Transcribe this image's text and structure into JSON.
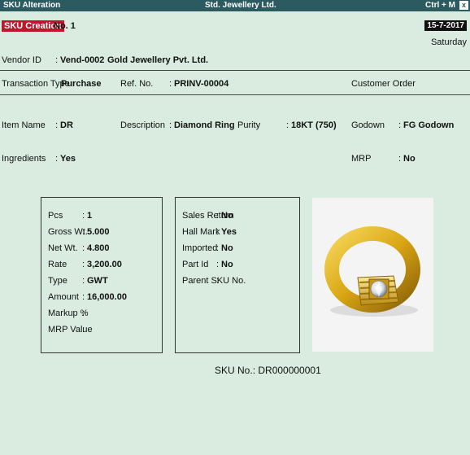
{
  "window": {
    "title": "SKU Alteration",
    "company": "Std. Jewellery Ltd.",
    "shortcut": "Ctrl + M",
    "close_glyph": "x"
  },
  "header": {
    "mode_label": "SKU Creation",
    "number_label": "No. 1",
    "date": "15-7-2017",
    "day": "Saturday"
  },
  "vendor": {
    "id_label": "Vendor ID",
    "id_value": "Vend-0002",
    "name": "Gold Jewellery Pvt. Ltd."
  },
  "transaction": {
    "type_label": "Transaction Type",
    "type_value": "Purchase",
    "ref_label": "Ref. No.",
    "ref_value": "PRINV-00004",
    "customer_order_label": "Customer Order"
  },
  "item": {
    "name_label": "Item Name",
    "name_value": "DR",
    "description_label": "Description",
    "description_value": "Diamond Ring",
    "purity_label": "Purity",
    "purity_value": "18KT (750)",
    "godown_label": "Godown",
    "godown_value": "FG Godown",
    "ingredients_label": "Ingredients",
    "ingredients_value": "Yes",
    "mrp_label": "MRP",
    "mrp_value": "No"
  },
  "left_box": {
    "rows": [
      {
        "label": "Pcs",
        "value": "1"
      },
      {
        "label": "Gross Wt.",
        "value": "5.000"
      },
      {
        "label": "Net Wt.",
        "value": "4.800"
      },
      {
        "label": "Rate",
        "value": "3,200.00"
      },
      {
        "label": "Type",
        "value": "GWT"
      },
      {
        "label": "Amount",
        "value": "16,000.00"
      },
      {
        "label": "Markup %",
        "value": ""
      },
      {
        "label": "MRP Value",
        "value": ""
      }
    ]
  },
  "right_box": {
    "rows": [
      {
        "label": "Sales Return",
        "value": "No"
      },
      {
        "label": "Hall Mark",
        "value": "Yes"
      },
      {
        "label": "Imported",
        "value": "No"
      },
      {
        "label": "Part Id",
        "value": "No"
      },
      {
        "label": "Parent SKU No.",
        "value": ""
      }
    ]
  },
  "sku": {
    "label": "SKU No.",
    "value": "DR000000001"
  },
  "colors": {
    "background": "#d9ecdf",
    "titlebar": "#2b5a60",
    "badge_red": "#c0152b",
    "gold": "#d9a514"
  },
  "icons": {
    "close": "close-icon",
    "product_image": "gold-diamond-ring"
  }
}
